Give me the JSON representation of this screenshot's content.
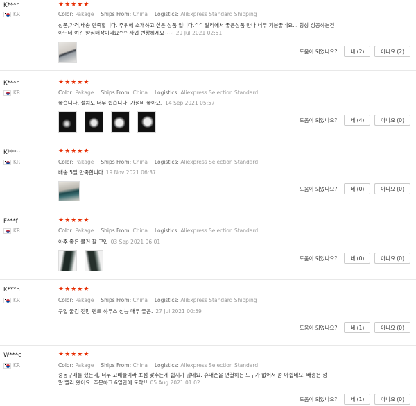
{
  "labels": {
    "color": "Color:",
    "ships_from": "Ships From:",
    "logistics": "Logistics:",
    "helpful_question": "도움이 되었나요?",
    "yes": "네",
    "no": "아니요"
  },
  "reviews": [
    {
      "user": "K***r",
      "country": "KR",
      "stars": 5,
      "color": "Pakage",
      "ships_from": "China",
      "logistics": "AliExpress Standard Shipping",
      "text_line1": "상품,가격,배송 만족합니다. 주위에 소개하고 싶은 상품 입니다.^^ 알리에서 좋은상품 만나 너무 기분좋네요... 항상 성공하는건",
      "text_line2": "아닌데 여긴 양심매장이네요^^ 사업 번창하세요~~",
      "date": "29 Jul 2021 02:51",
      "yes_count": "(2)",
      "no_count": "(2)"
    },
    {
      "user": "K***r",
      "country": "KR",
      "stars": 5,
      "color": "Pakage",
      "ships_from": "China",
      "logistics": "Aliexpress Selection Standard",
      "text_line1": "좋습니다. 설치도 너무 쉽습니다. 가성비 좋아요.",
      "text_line2": "",
      "date": "14 Sep 2021 05:57",
      "yes_count": "(4)",
      "no_count": "(0)"
    },
    {
      "user": "K***m",
      "country": "KR",
      "stars": 5,
      "color": "Pakage",
      "ships_from": "China",
      "logistics": "Aliexpress Selection Standard",
      "text_line1": "배송 5일 만족합니다",
      "text_line2": "",
      "date": "19 Nov 2021 06:37",
      "yes_count": "(0)",
      "no_count": "(0)"
    },
    {
      "user": "F***f",
      "country": "KR",
      "stars": 5,
      "color": "Pakage",
      "ships_from": "China",
      "logistics": "Aliexpress Selection Standard",
      "text_line1": "아주 좋은 물건 잘 구입",
      "text_line2": "",
      "date": "03 Sep 2021 06:01",
      "yes_count": "(0)",
      "no_count": "(0)"
    },
    {
      "user": "K***n",
      "country": "KR",
      "stars": 5,
      "color": "Pakage",
      "ships_from": "China",
      "logistics": "AliExpress Standard Shipping",
      "text_line1": "구입 물김 전망 펜트 하우스 성능 매우 좋음.",
      "text_line2": "",
      "date": "27 Jul 2021 00:59",
      "yes_count": "(1)",
      "no_count": "(0)"
    },
    {
      "user": "W***e",
      "country": "KR",
      "stars": 5,
      "color": "Pakage",
      "ships_from": "China",
      "logistics": "Aliexpress Selection Standard",
      "text_line1": "중동구매를 했는데, 너무 고배율이라 초점 맞추는게 쉽지가 않네요. 휴대폰을 연결하는 도구가 없어서 좀 아쉽네요. 배송은 정",
      "text_line2": "말 빨리 왔어요. 주문하고 6일만에 도착!!",
      "date": "05 Aug 2021 01:02",
      "yes_count": "(1)",
      "no_count": "(0)"
    }
  ]
}
